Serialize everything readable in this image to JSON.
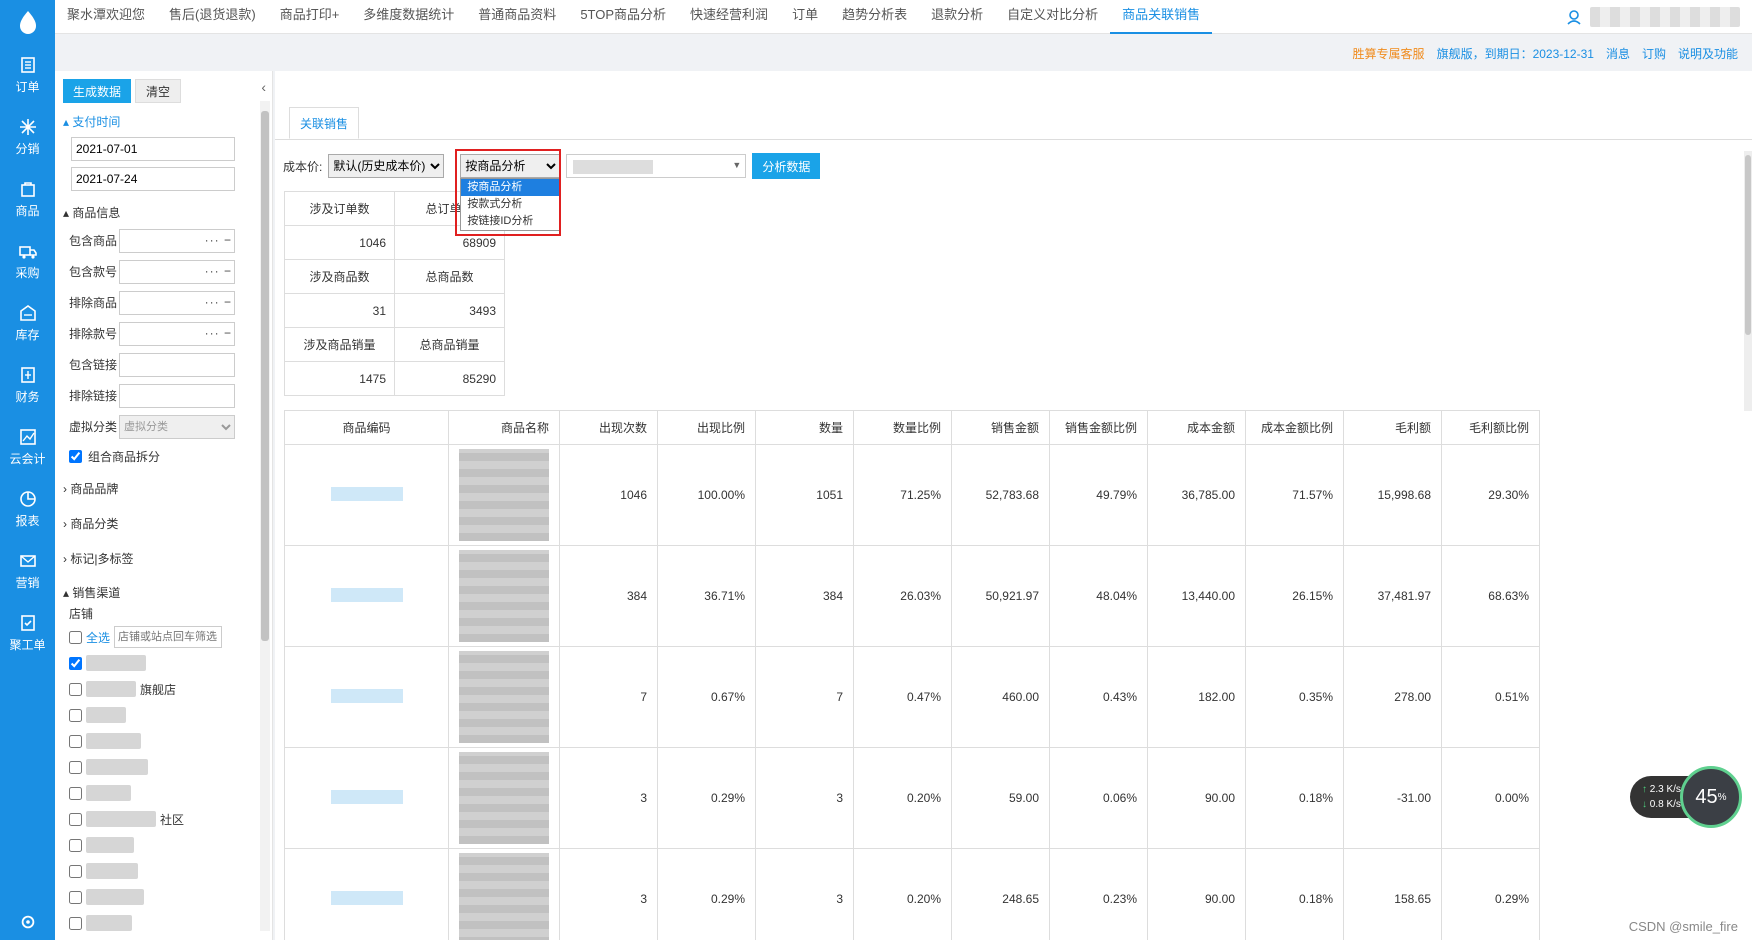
{
  "rail": {
    "items": [
      {
        "label": "订单",
        "icon": "document-icon"
      },
      {
        "label": "分销",
        "icon": "snowflake-icon"
      },
      {
        "label": "商品",
        "icon": "bag-icon"
      },
      {
        "label": "采购",
        "icon": "truck-icon"
      },
      {
        "label": "库存",
        "icon": "warehouse-icon"
      },
      {
        "label": "财务",
        "icon": "ledger-icon"
      },
      {
        "label": "云会计",
        "icon": "chart-icon"
      },
      {
        "label": "报表",
        "icon": "pie-icon"
      },
      {
        "label": "营销",
        "icon": "mail-icon"
      },
      {
        "label": "聚工单",
        "icon": "checklist-icon"
      }
    ]
  },
  "topnav": {
    "tabs": [
      "聚水潭欢迎您",
      "售后(退货退款)",
      "商品打印+",
      "多维度数据统计",
      "普通商品资料",
      "5TOP商品分析",
      "快速经营利润",
      "订单",
      "趋势分析表",
      "退款分析",
      "自定义对比分析",
      "商品关联销售"
    ],
    "active_index": 11
  },
  "infobar": {
    "service": "胜算专属客服",
    "expiry": "旗舰版，到期日：2023-12-31",
    "message": "消息",
    "order": "订购",
    "help": "说明及功能"
  },
  "filter": {
    "generate": "生成数据",
    "clear": "清空",
    "pay_time": "支付时间",
    "date_from": "2021-07-01",
    "date_to": "2021-07-24",
    "goods_info": "商品信息",
    "rows": [
      "包含商品",
      "包含款号",
      "排除商品",
      "排除款号",
      "包含链接",
      "排除链接"
    ],
    "virtual_cat_label": "虚拟分类",
    "virtual_cat_placeholder": "虚拟分类",
    "combo_split": "组合商品拆分",
    "brand": "商品品牌",
    "category": "商品分类",
    "tags": "标记|多标签",
    "channel": "销售渠道",
    "shop": "店铺",
    "select_all": "全选",
    "shop_filter_placeholder": "店铺或站点回车筛选",
    "shop_suffix_1": "旗舰店",
    "shop_suffix_2": "社区"
  },
  "main": {
    "tab": "关联销售",
    "cost_label": "成本价:",
    "cost_value": "默认(历史成本价)",
    "analysis_value": "按商品分析",
    "analysis_options": [
      "按商品分析",
      "按款式分析",
      "按链接ID分析"
    ],
    "analyze_button": "分析数据"
  },
  "summary": [
    {
      "h1": "涉及订单数",
      "h2": "总订单数",
      "v1": "1046",
      "v2": "68909"
    },
    {
      "h1": "涉及商品数",
      "h2": "总商品数",
      "v1": "31",
      "v2": "3493"
    },
    {
      "h1": "涉及商品销量",
      "h2": "总商品销量",
      "v1": "1475",
      "v2": "85290"
    }
  ],
  "table": {
    "headers": [
      "商品编码",
      "商品名称",
      "出现次数",
      "出现比例",
      "数量",
      "数量比例",
      "销售金额",
      "销售金额比例",
      "成本金额",
      "成本金额比例",
      "毛利额",
      "毛利额比例"
    ],
    "rows": [
      [
        "1046",
        "100.00%",
        "1051",
        "71.25%",
        "52,783.68",
        "49.79%",
        "36,785.00",
        "71.57%",
        "15,998.68",
        "29.30%"
      ],
      [
        "384",
        "36.71%",
        "384",
        "26.03%",
        "50,921.97",
        "48.04%",
        "13,440.00",
        "26.15%",
        "37,481.97",
        "68.63%"
      ],
      [
        "7",
        "0.67%",
        "7",
        "0.47%",
        "460.00",
        "0.43%",
        "182.00",
        "0.35%",
        "278.00",
        "0.51%"
      ],
      [
        "3",
        "0.29%",
        "3",
        "0.20%",
        "59.00",
        "0.06%",
        "90.00",
        "0.18%",
        "-31.00",
        "0.00%"
      ],
      [
        "3",
        "0.29%",
        "3",
        "0.20%",
        "248.65",
        "0.23%",
        "90.00",
        "0.18%",
        "158.65",
        "0.29%"
      ]
    ]
  },
  "speed": {
    "up": "2.3",
    "down": "0.8",
    "unit": "K/s",
    "percent": "45"
  },
  "watermark": "CSDN @smile_fire",
  "colors": {
    "accent": "#1a8fe3",
    "highlight": "#e02020",
    "orange": "#f08c1e"
  }
}
